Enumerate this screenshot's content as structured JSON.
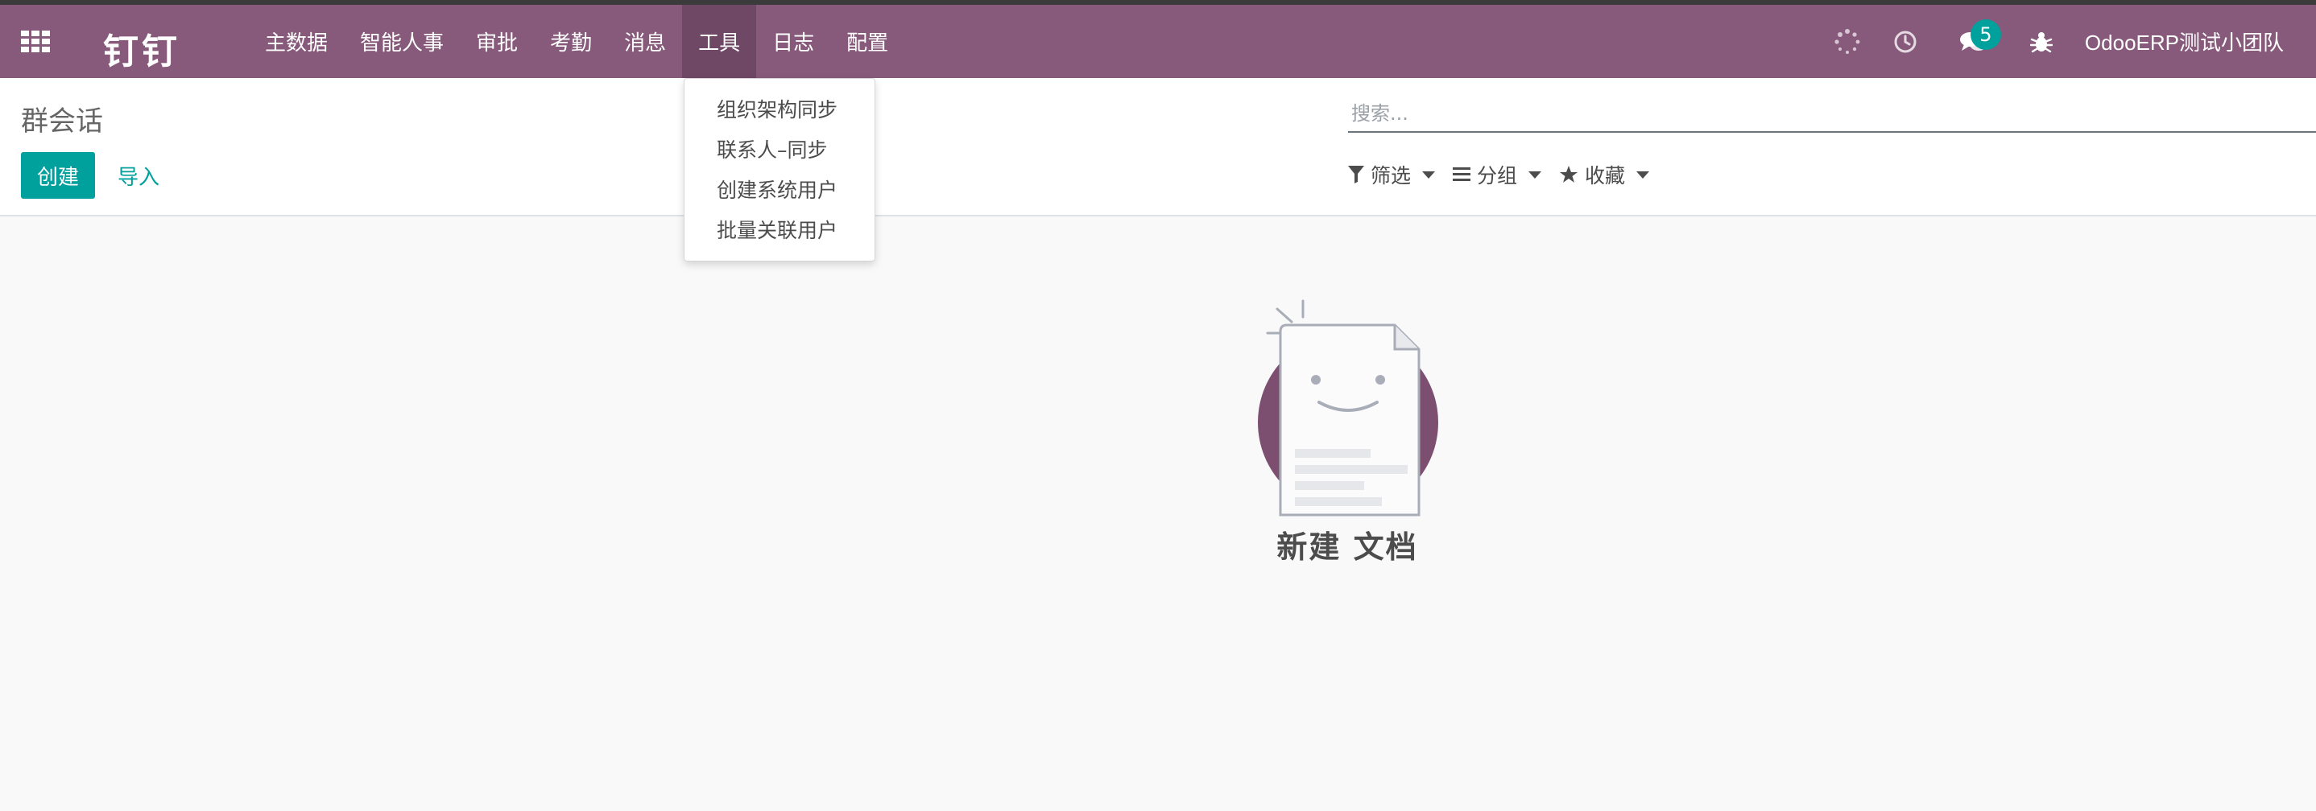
{
  "navbar": {
    "brand": "钉钉",
    "menu": [
      {
        "label": "主数据"
      },
      {
        "label": "智能人事"
      },
      {
        "label": "审批"
      },
      {
        "label": "考勤"
      },
      {
        "label": "消息"
      },
      {
        "label": "工具"
      },
      {
        "label": "日志"
      },
      {
        "label": "配置"
      }
    ],
    "active_menu": "工具",
    "messages_badge": "5",
    "user_name": "OdooERP测试小团队",
    "color": "#875a7b"
  },
  "tools_dropdown": {
    "items": [
      {
        "label": "组织架构同步"
      },
      {
        "label": "联系人–同步"
      },
      {
        "label": "创建系统用户"
      },
      {
        "label": "批量关联用户"
      }
    ]
  },
  "control_panel": {
    "title": "群会话",
    "create_label": "创建",
    "import_label": "导入",
    "search_placeholder": "搜索...",
    "filter_label": "筛选",
    "group_label": "分组",
    "favorites_label": "收藏",
    "accent": "#00a09d"
  },
  "empty_state": {
    "text": "新建 文档"
  },
  "icons": [
    "apps-grid-icon",
    "spinner-icon",
    "clock-icon",
    "chat-icon",
    "bug-icon",
    "filter-icon",
    "list-icon",
    "star-icon",
    "smiley-document-icon"
  ]
}
